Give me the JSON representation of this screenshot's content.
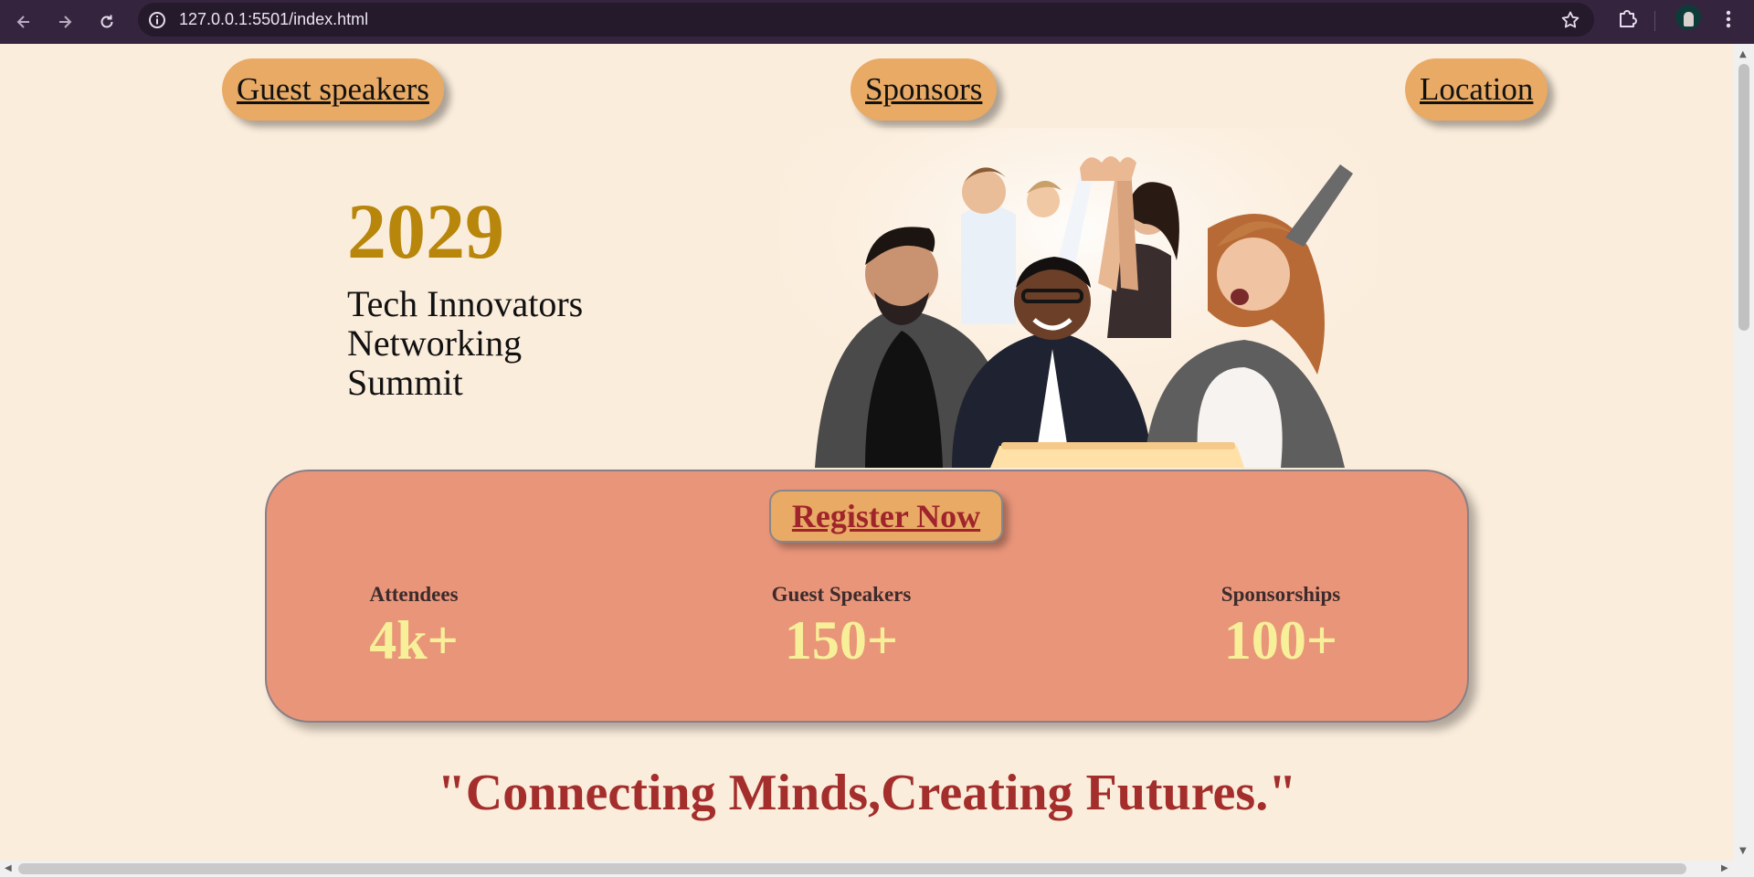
{
  "browser": {
    "url": "127.0.0.1:5501/index.html",
    "icons": [
      "back-arrow-icon",
      "forward-arrow-icon",
      "reload-icon",
      "site-info-icon",
      "bookmark-star-icon",
      "extensions-icon",
      "profile-avatar",
      "menu-dots-icon"
    ]
  },
  "nav": {
    "guest_speakers": "Guest speakers",
    "sponsors": "Sponsors",
    "location": "Location"
  },
  "hero": {
    "year": "2029",
    "title_lines": [
      "Tech Innovators",
      "Networking",
      "Summit"
    ]
  },
  "panel": {
    "register_label": "Register Now",
    "stats": [
      {
        "label": "Attendees",
        "value": "4k+"
      },
      {
        "label": "Guest Speakers",
        "value": "150+"
      },
      {
        "label": "Sponsorships",
        "value": "100+"
      }
    ]
  },
  "tagline": "\"Connecting Minds,Creating Futures.\"",
  "colors": {
    "page_background": "#fbeddc",
    "nav_pill": "#e8aa65",
    "year": "#b8860b",
    "panel": "#e9957a",
    "register_text": "#a0242b",
    "stat_value": "#f7f099",
    "tagline": "#a32e2b"
  }
}
